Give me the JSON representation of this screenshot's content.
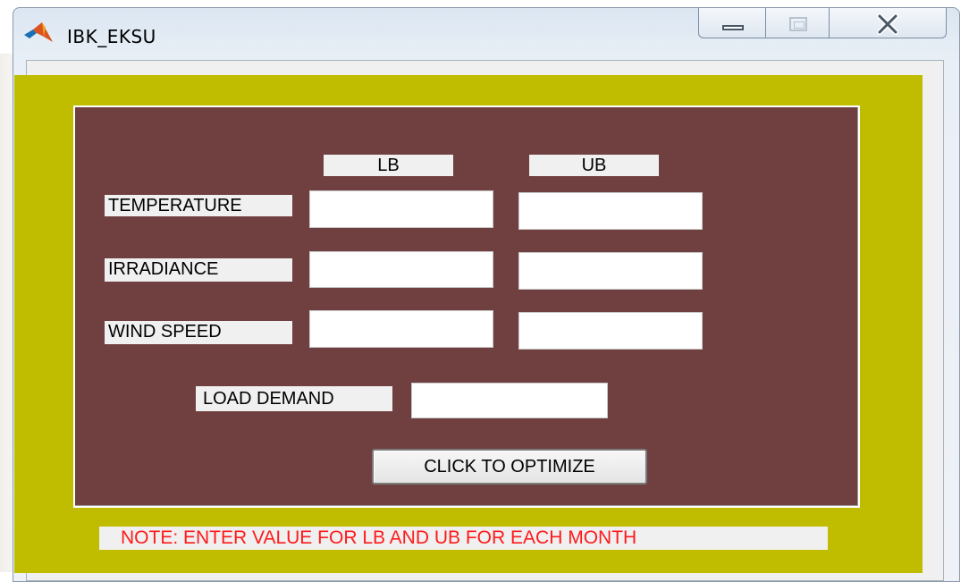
{
  "window": {
    "title": "IBK_EKSU",
    "controls": {
      "minimize_icon": "minimize-icon",
      "maximize_icon": "maximize-icon",
      "close_icon": "close-icon"
    }
  },
  "form": {
    "column_headers": {
      "lb": "LB",
      "ub": "UB"
    },
    "rows": [
      {
        "label": "TEMPERATURE",
        "lb_value": "",
        "ub_value": ""
      },
      {
        "label": "IRRADIANCE",
        "lb_value": "",
        "ub_value": ""
      },
      {
        "label": "WIND SPEED",
        "lb_value": "",
        "ub_value": ""
      }
    ],
    "load_demand": {
      "label": "LOAD DEMAND",
      "value": ""
    },
    "optimize_button": "CLICK TO OPTIMIZE"
  },
  "note": "NOTE: ENTER VALUE FOR LB AND UB FOR EACH MONTH",
  "colors": {
    "figure_background": "#c0bd00",
    "panel_background": "#704040",
    "note_text": "#ff1a1a"
  }
}
